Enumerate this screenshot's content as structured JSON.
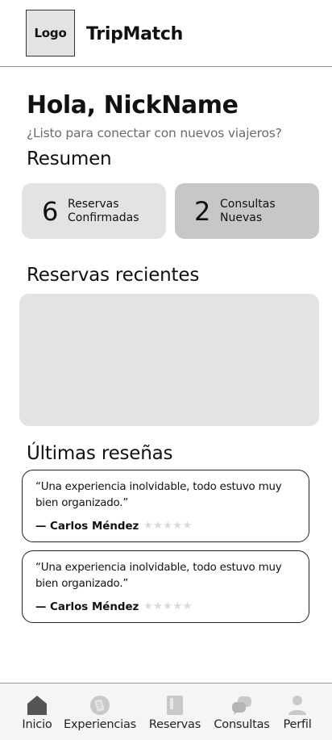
{
  "header": {
    "logo_text": "Logo",
    "app_title": "TripMatch"
  },
  "greeting": {
    "title": "Hola, NickName",
    "subtitle": "¿Listo para conectar con nuevos viajeros?"
  },
  "summary": {
    "title": "Resumen",
    "cards": [
      {
        "count": "6",
        "label_line1": "Reservas",
        "label_line2": "Confirmadas"
      },
      {
        "count": "2",
        "label_line1": "Consultas",
        "label_line2": "Nuevas"
      }
    ]
  },
  "recent": {
    "title": "Reservas recientes"
  },
  "reviews": {
    "title": "Últimas reseñas",
    "items": [
      {
        "quote": "“Una experiencia inolvidable, todo estuvo muy bien organizado.”",
        "author": "— Carlos Méndez",
        "stars": "★★★★★"
      },
      {
        "quote": "“Una experiencia inolvidable, todo estuvo muy bien organizado.”",
        "author": "— Carlos Méndez",
        "stars": "★★★★★"
      }
    ]
  },
  "nav": {
    "items": [
      {
        "label": "Inicio",
        "icon": "home-icon",
        "active": true
      },
      {
        "label": "Experiencias",
        "icon": "experiences-icon",
        "active": false
      },
      {
        "label": "Reservas",
        "icon": "bookings-icon",
        "active": false
      },
      {
        "label": "Consultas",
        "icon": "chat-icon",
        "active": false
      },
      {
        "label": "Perfil",
        "icon": "profile-icon",
        "active": false
      }
    ]
  },
  "colors": {
    "card_light": "#e3e3e3",
    "card_dark": "#c7c7c7",
    "icon_inactive": "#c9c9c9",
    "icon_active": "#555555"
  }
}
